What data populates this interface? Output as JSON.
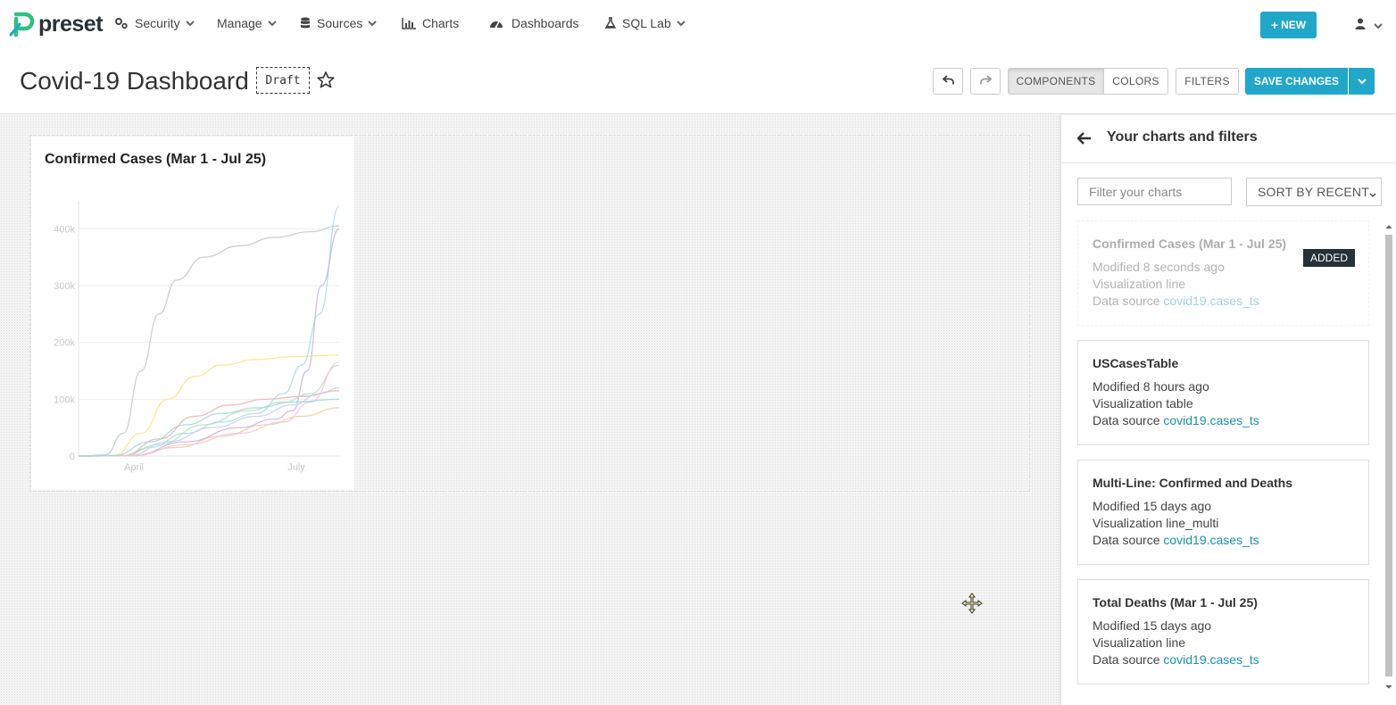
{
  "app": {
    "brand": "preset",
    "nav": [
      {
        "label": "Security",
        "icon": "gears-icon",
        "dropdown": true
      },
      {
        "label": "Manage",
        "icon": "",
        "dropdown": true
      },
      {
        "label": "Sources",
        "icon": "database-icon",
        "dropdown": true
      },
      {
        "label": "Charts",
        "icon": "bar-chart-icon",
        "dropdown": false
      },
      {
        "label": "Dashboards",
        "icon": "dashboard-icon",
        "dropdown": false
      },
      {
        "label": "SQL Lab",
        "icon": "flask-icon",
        "dropdown": true
      }
    ],
    "new_label": "NEW"
  },
  "header": {
    "title": "Covid-19 Dashboard",
    "draft_label": "Draft",
    "components_label": "COMPONENTS",
    "colors_label": "COLORS",
    "filters_label": "FILTERS",
    "save_label": "SAVE CHANGES"
  },
  "chart_card": {
    "title": "Confirmed Cases (Mar 1 - Jul 25)"
  },
  "chart_data": {
    "type": "line",
    "title": "Confirmed Cases (Mar 1 - Jul 25)",
    "xlabel": "",
    "ylabel": "",
    "x_ticks": [
      "April",
      "July"
    ],
    "y_ticks": [
      "0",
      "100k",
      "200k",
      "300k",
      "400k"
    ],
    "ylim": [
      0,
      440000
    ],
    "xlim": [
      0,
      146
    ],
    "x_tick_positions": [
      31,
      122
    ],
    "series": [
      {
        "color": "#bfc8cf",
        "points": [
          [
            0,
            0
          ],
          [
            15,
            2000
          ],
          [
            25,
            40000
          ],
          [
            35,
            150000
          ],
          [
            45,
            250000
          ],
          [
            55,
            310000
          ],
          [
            70,
            350000
          ],
          [
            90,
            370000
          ],
          [
            110,
            385000
          ],
          [
            130,
            395000
          ],
          [
            146,
            405000
          ]
        ]
      },
      {
        "color": "#f3e58c",
        "points": [
          [
            0,
            0
          ],
          [
            20,
            500
          ],
          [
            35,
            40000
          ],
          [
            50,
            100000
          ],
          [
            65,
            140000
          ],
          [
            80,
            160000
          ],
          [
            100,
            170000
          ],
          [
            120,
            175000
          ],
          [
            146,
            178000
          ]
        ]
      },
      {
        "color": "#a6dce8",
        "points": [
          [
            0,
            0
          ],
          [
            25,
            500
          ],
          [
            40,
            15000
          ],
          [
            60,
            40000
          ],
          [
            80,
            60000
          ],
          [
            100,
            75000
          ],
          [
            115,
            110000
          ],
          [
            125,
            160000
          ],
          [
            135,
            250000
          ],
          [
            146,
            440000
          ]
        ]
      },
      {
        "color": "#c9b4dc",
        "points": [
          [
            0,
            0
          ],
          [
            30,
            500
          ],
          [
            60,
            25000
          ],
          [
            90,
            50000
          ],
          [
            110,
            65000
          ],
          [
            120,
            80000
          ],
          [
            128,
            150000
          ],
          [
            136,
            300000
          ],
          [
            146,
            400000
          ]
        ]
      },
      {
        "color": "#e6b3b3",
        "points": [
          [
            0,
            0
          ],
          [
            25,
            1000
          ],
          [
            45,
            30000
          ],
          [
            65,
            70000
          ],
          [
            85,
            90000
          ],
          [
            105,
            100000
          ],
          [
            125,
            105000
          ],
          [
            146,
            115000
          ]
        ]
      },
      {
        "color": "#b5e0c0",
        "points": [
          [
            0,
            0
          ],
          [
            25,
            500
          ],
          [
            45,
            20000
          ],
          [
            70,
            55000
          ],
          [
            95,
            80000
          ],
          [
            115,
            95000
          ],
          [
            130,
            110000
          ],
          [
            146,
            160000
          ]
        ]
      },
      {
        "color": "#c7d0e8",
        "points": [
          [
            0,
            0
          ],
          [
            28,
            500
          ],
          [
            50,
            25000
          ],
          [
            75,
            50000
          ],
          [
            100,
            70000
          ],
          [
            120,
            90000
          ],
          [
            135,
            110000
          ],
          [
            146,
            120000
          ]
        ]
      },
      {
        "color": "#f0c9a6",
        "points": [
          [
            0,
            0
          ],
          [
            30,
            500
          ],
          [
            55,
            15000
          ],
          [
            80,
            35000
          ],
          [
            105,
            55000
          ],
          [
            125,
            70000
          ],
          [
            146,
            85000
          ]
        ]
      },
      {
        "color": "#f2c6de",
        "points": [
          [
            0,
            0
          ],
          [
            30,
            500
          ],
          [
            60,
            20000
          ],
          [
            90,
            40000
          ],
          [
            115,
            60000
          ],
          [
            130,
            95000
          ],
          [
            146,
            165000
          ]
        ]
      },
      {
        "color": "#9fd8d1",
        "points": [
          [
            0,
            0
          ],
          [
            20,
            1000
          ],
          [
            40,
            25000
          ],
          [
            60,
            55000
          ],
          [
            80,
            75000
          ],
          [
            100,
            85000
          ],
          [
            120,
            95000
          ],
          [
            146,
            100000
          ]
        ]
      }
    ]
  },
  "sidebar": {
    "title": "Your charts and filters",
    "filter_placeholder": "Filter your charts",
    "sort_label": "SORT BY RECENT",
    "cards": [
      {
        "title": "Confirmed Cases (Mar 1 - Jul 25)",
        "modified": "Modified 8 seconds ago",
        "viz_prefix": "Visualization",
        "viz": "line",
        "source_prefix": "Data source",
        "source": "covid19.cases_ts",
        "added": "ADDED"
      },
      {
        "title": "USCasesTable",
        "modified": "Modified 8 hours ago",
        "viz_prefix": "Visualization",
        "viz": "table",
        "source_prefix": "Data source",
        "source": "covid19.cases_ts"
      },
      {
        "title": "Multi-Line: Confirmed and Deaths",
        "modified": "Modified 15 days ago",
        "viz_prefix": "Visualization",
        "viz": "line_multi",
        "source_prefix": "Data source",
        "source": "covid19.cases_ts"
      },
      {
        "title": "Total Deaths (Mar 1 - Jul 25)",
        "modified": "Modified 15 days ago",
        "viz_prefix": "Visualization",
        "viz": "line",
        "source_prefix": "Data source",
        "source": "covid19.cases_ts"
      }
    ]
  },
  "colors": {
    "accent": "#20a7c9",
    "brand_green": "#2ec27e",
    "dark": "#263238"
  }
}
